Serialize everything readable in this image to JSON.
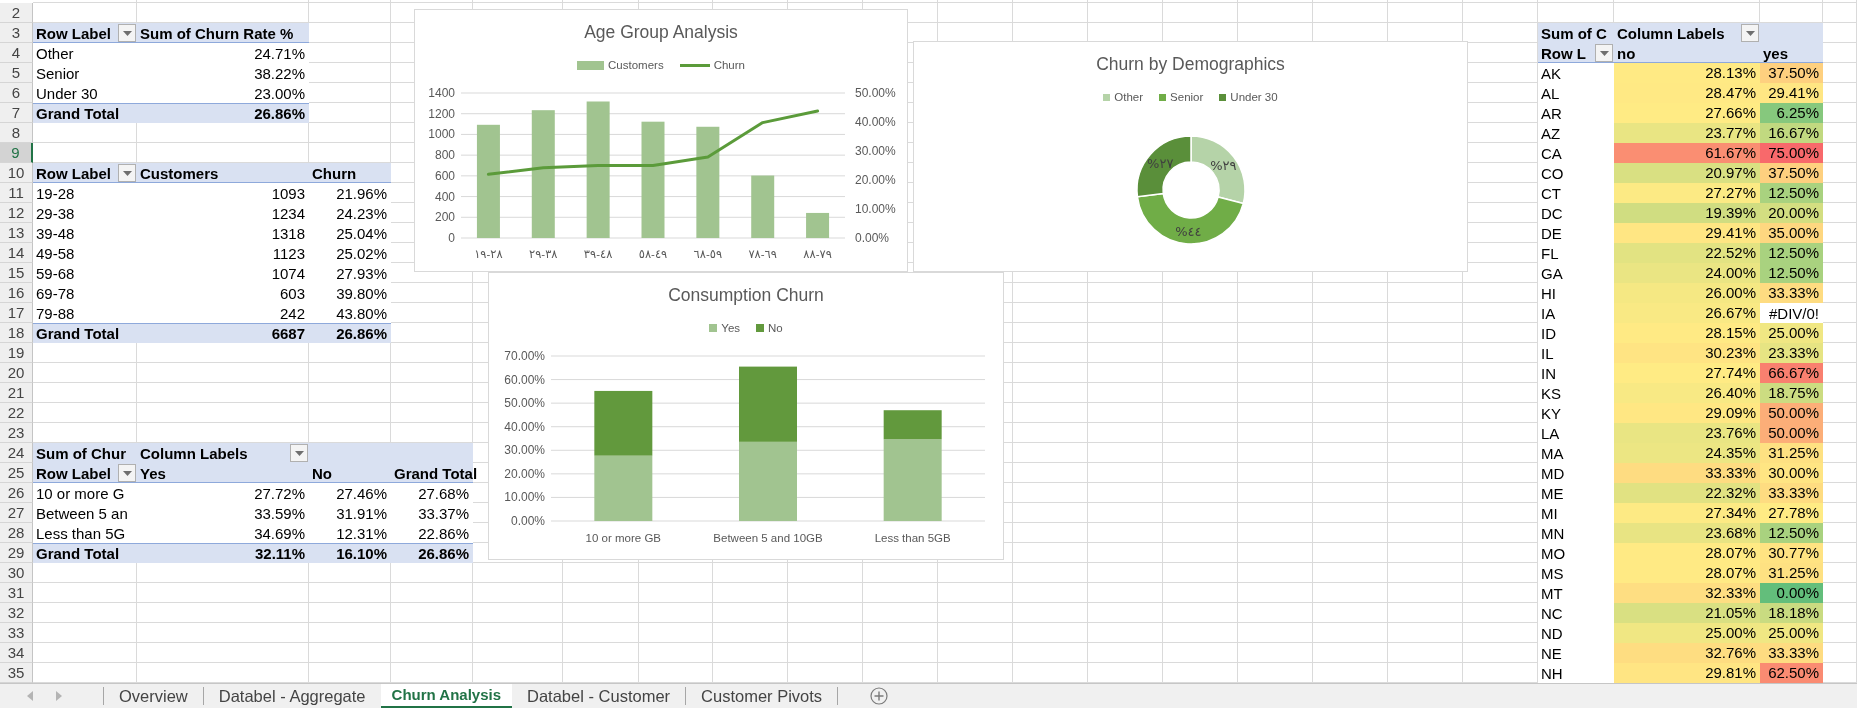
{
  "row_numbers": [
    {
      "label": "2",
      "selected": false
    },
    {
      "label": "3",
      "selected": false
    },
    {
      "label": "4",
      "selected": false
    },
    {
      "label": "5",
      "selected": false
    },
    {
      "label": "6",
      "selected": false
    },
    {
      "label": "7",
      "selected": false
    },
    {
      "label": "8",
      "selected": false
    },
    {
      "label": "9",
      "selected": true
    },
    {
      "label": "10",
      "selected": false
    },
    {
      "label": "11",
      "selected": false
    },
    {
      "label": "12",
      "selected": false
    },
    {
      "label": "13",
      "selected": false
    },
    {
      "label": "14",
      "selected": false
    },
    {
      "label": "15",
      "selected": false
    },
    {
      "label": "16",
      "selected": false
    },
    {
      "label": "17",
      "selected": false
    },
    {
      "label": "18",
      "selected": false
    },
    {
      "label": "19",
      "selected": false
    },
    {
      "label": "20",
      "selected": false
    },
    {
      "label": "21",
      "selected": false
    },
    {
      "label": "22",
      "selected": false
    },
    {
      "label": "23",
      "selected": false
    },
    {
      "label": "24",
      "selected": false
    },
    {
      "label": "25",
      "selected": false
    },
    {
      "label": "26",
      "selected": false
    },
    {
      "label": "27",
      "selected": false
    },
    {
      "label": "28",
      "selected": false
    },
    {
      "label": "29",
      "selected": false
    },
    {
      "label": "30",
      "selected": false
    },
    {
      "label": "31",
      "selected": false
    },
    {
      "label": "32",
      "selected": false
    },
    {
      "label": "33",
      "selected": false
    },
    {
      "label": "34",
      "selected": false
    },
    {
      "label": "35",
      "selected": false
    }
  ],
  "pivot_tables": [
    {
      "header_rows": [
        [
          {
            "text": "Row Label",
            "filter": true
          },
          {
            "text": "Sum of Churn Rate %",
            "filter": false
          }
        ]
      ],
      "rows": [
        [
          "Other",
          "24.71%"
        ],
        [
          "Senior",
          "38.22%"
        ],
        [
          "Under 30",
          "23.00%"
        ]
      ],
      "total": [
        "Grand Total",
        "26.86%"
      ]
    },
    {
      "header_rows": [
        [
          {
            "text": "Row Label",
            "filter": true
          },
          {
            "text": "Customers",
            "filter": false
          },
          {
            "text": "Churn",
            "filter": false
          }
        ]
      ],
      "rows": [
        [
          "19-28",
          "1093",
          "21.96%"
        ],
        [
          "29-38",
          "1234",
          "24.23%"
        ],
        [
          "39-48",
          "1318",
          "25.04%"
        ],
        [
          "49-58",
          "1123",
          "25.02%"
        ],
        [
          "59-68",
          "1074",
          "27.93%"
        ],
        [
          "69-78",
          "603",
          "39.80%"
        ],
        [
          "79-88",
          "242",
          "43.80%"
        ]
      ],
      "total": [
        "Grand Total",
        "6687",
        "26.86%"
      ]
    },
    {
      "header_rows": [
        [
          {
            "text": "Sum of Chur",
            "filter": false
          },
          {
            "text": "Column Labels",
            "filter": true
          }
        ],
        [
          {
            "text": "Row Label",
            "filter": true
          },
          {
            "text": "Yes",
            "filter": false
          },
          {
            "text": "No",
            "filter": false
          },
          {
            "text": "Grand Total",
            "filter": false
          }
        ]
      ],
      "rows": [
        [
          "10 or more G",
          "27.72%",
          "27.46%",
          "27.68%"
        ],
        [
          "Between 5 an",
          "33.59%",
          "31.91%",
          "33.37%"
        ],
        [
          "Less than 5G",
          "34.69%",
          "12.31%",
          "22.86%"
        ]
      ],
      "total": [
        "Grand Total",
        "32.11%",
        "16.10%",
        "26.86%"
      ]
    },
    {
      "header_rows": [
        [
          {
            "text": "Sum of C",
            "filter": false
          },
          {
            "text": "Column Labels",
            "filter": true
          }
        ],
        [
          {
            "text": "Row L",
            "filter": true
          },
          {
            "text": "no",
            "filter": false
          },
          {
            "text": "yes",
            "filter": false
          }
        ]
      ],
      "rows": [
        [
          {
            "text": "AK"
          },
          {
            "text": "28.13%",
            "color": "#ffea84"
          },
          {
            "text": "37.50%",
            "color": "#fed07f"
          }
        ],
        [
          {
            "text": "AL"
          },
          {
            "text": "28.47%",
            "color": "#ffe984"
          },
          {
            "text": "29.41%",
            "color": "#ffe683"
          }
        ],
        [
          {
            "text": "AR"
          },
          {
            "text": "27.66%",
            "color": "#ffeb84"
          },
          {
            "text": "6.25%",
            "color": "#86c87d"
          }
        ],
        [
          {
            "text": "AZ"
          },
          {
            "text": "23.77%",
            "color": "#e9e583"
          },
          {
            "text": "16.67%",
            "color": "#c1d980"
          }
        ],
        [
          {
            "text": "CA"
          },
          {
            "text": "61.67%",
            "color": "#fa8e72"
          },
          {
            "text": "75.00%",
            "color": "#f8696b"
          }
        ],
        [
          {
            "text": "CO"
          },
          {
            "text": "20.97%",
            "color": "#d9e082"
          },
          {
            "text": "37.50%",
            "color": "#fed07f"
          }
        ],
        [
          {
            "text": "CT"
          },
          {
            "text": "27.27%",
            "color": "#fcea84"
          },
          {
            "text": "12.50%",
            "color": "#a9d27f"
          }
        ],
        [
          {
            "text": "DC"
          },
          {
            "text": "19.39%",
            "color": "#d0dd81"
          },
          {
            "text": "20.00%",
            "color": "#d3de81"
          }
        ],
        [
          {
            "text": "DE"
          },
          {
            "text": "29.41%",
            "color": "#ffe683"
          },
          {
            "text": "35.00%",
            "color": "#fed780"
          }
        ],
        [
          {
            "text": "FL"
          },
          {
            "text": "22.52%",
            "color": "#e2e382"
          },
          {
            "text": "12.50%",
            "color": "#a9d27f"
          }
        ],
        [
          {
            "text": "GA"
          },
          {
            "text": "24.00%",
            "color": "#eae583"
          },
          {
            "text": "12.50%",
            "color": "#a9d27f"
          }
        ],
        [
          {
            "text": "HI"
          },
          {
            "text": "26.00%",
            "color": "#f5e883"
          },
          {
            "text": "33.33%",
            "color": "#fedc81"
          }
        ],
        [
          {
            "text": "IA"
          },
          {
            "text": "26.67%",
            "color": "#f9e984"
          },
          {
            "text": "#DIV/0!"
          }
        ],
        [
          {
            "text": "ID"
          },
          {
            "text": "28.15%",
            "color": "#ffea84"
          },
          {
            "text": "25.00%",
            "color": "#f0e783"
          }
        ],
        [
          {
            "text": "IL"
          },
          {
            "text": "30.23%",
            "color": "#ffe483"
          },
          {
            "text": "23.33%",
            "color": "#e6e483"
          }
        ],
        [
          {
            "text": "IN"
          },
          {
            "text": "27.74%",
            "color": "#ffeb84"
          },
          {
            "text": "66.67%",
            "color": "#f9806f"
          }
        ],
        [
          {
            "text": "KS"
          },
          {
            "text": "26.40%",
            "color": "#f8e984"
          },
          {
            "text": "18.75%",
            "color": "#ccdc81"
          }
        ],
        [
          {
            "text": "KY"
          },
          {
            "text": "29.09%",
            "color": "#ffe783"
          },
          {
            "text": "50.00%",
            "color": "#fcae78"
          }
        ],
        [
          {
            "text": "LA"
          },
          {
            "text": "23.76%",
            "color": "#e9e583"
          },
          {
            "text": "50.00%",
            "color": "#fcae78"
          }
        ],
        [
          {
            "text": "MA"
          },
          {
            "text": "24.35%",
            "color": "#ece683"
          },
          {
            "text": "31.25%",
            "color": "#fee182"
          }
        ],
        [
          {
            "text": "MD"
          },
          {
            "text": "33.33%",
            "color": "#fedc81"
          },
          {
            "text": "30.00%",
            "color": "#ffe583"
          }
        ],
        [
          {
            "text": "ME"
          },
          {
            "text": "22.32%",
            "color": "#e1e282"
          },
          {
            "text": "33.33%",
            "color": "#fedc81"
          }
        ],
        [
          {
            "text": "MI"
          },
          {
            "text": "27.34%",
            "color": "#fdea84"
          },
          {
            "text": "27.78%",
            "color": "#ffeb84"
          }
        ],
        [
          {
            "text": "MN"
          },
          {
            "text": "23.68%",
            "color": "#e8e483"
          },
          {
            "text": "12.50%",
            "color": "#a9d27f"
          }
        ],
        [
          {
            "text": "MO"
          },
          {
            "text": "28.07%",
            "color": "#ffea84"
          },
          {
            "text": "30.77%",
            "color": "#ffe382"
          }
        ],
        [
          {
            "text": "MS"
          },
          {
            "text": "28.07%",
            "color": "#ffea84"
          },
          {
            "text": "31.25%",
            "color": "#fee182"
          }
        ],
        [
          {
            "text": "MT"
          },
          {
            "text": "32.33%",
            "color": "#fede82"
          },
          {
            "text": "0.00%",
            "color": "#63be7b"
          }
        ],
        [
          {
            "text": "NC"
          },
          {
            "text": "21.05%",
            "color": "#d9e082"
          },
          {
            "text": "18.18%",
            "color": "#c9db81"
          }
        ],
        [
          {
            "text": "ND"
          },
          {
            "text": "25.00%",
            "color": "#f0e783"
          },
          {
            "text": "25.00%",
            "color": "#f0e783"
          }
        ],
        [
          {
            "text": "NE"
          },
          {
            "text": "32.76%",
            "color": "#fedd81"
          },
          {
            "text": "33.33%",
            "color": "#fedc81"
          }
        ],
        [
          {
            "text": "NH"
          },
          {
            "text": "29.81%",
            "color": "#ffe583"
          },
          {
            "text": "62.50%",
            "color": "#fa8b72"
          }
        ]
      ]
    }
  ],
  "charts": [
    {
      "chart_data": {
        "type": "bar",
        "title": "Age Group Analysis",
        "legend": "top",
        "grid": true,
        "categories": [
          "١٩-٢٨",
          "٢٩-٣٨",
          "٣٩-٤٨",
          "٥٨-٤٩",
          "٦٨-٥٩",
          "٧٨-٦٩",
          "٨٨-٧٩"
        ],
        "series": [
          {
            "name": "Customers",
            "type": "bar",
            "color": "#a1c490",
            "values": [
              1093,
              1234,
              1318,
              1123,
              1074,
              603,
              242
            ]
          },
          {
            "name": "Churn",
            "type": "line",
            "axis": "y2",
            "color": "#5b9b3a",
            "values": [
              0.2196,
              0.2423,
              0.2504,
              0.2502,
              0.2793,
              0.398,
              0.438
            ]
          }
        ],
        "ylim": [
          0,
          1400
        ],
        "yticks": [
          0,
          200,
          400,
          600,
          800,
          1000,
          1200,
          1400
        ],
        "y2lim": [
          0,
          0.5
        ],
        "y2ticks": [
          {
            "value": 0,
            "label": "0.00%"
          },
          {
            "value": 0.1,
            "label": "10.00%"
          },
          {
            "value": 0.2,
            "label": "20.00%"
          },
          {
            "value": 0.3,
            "label": "30.00%"
          },
          {
            "value": 0.4,
            "label": "40.00%"
          },
          {
            "value": 0.5,
            "label": "50.00%"
          }
        ]
      }
    },
    {
      "chart_data": {
        "type": "donut",
        "title": "Churn by Demographics",
        "legend": "top",
        "categories": [
          "Other",
          "Senior",
          "Under 30"
        ],
        "values": [
          29,
          44,
          27
        ],
        "colors": [
          "#b5d3a8",
          "#70ad47",
          "#5a8f3a"
        ],
        "value_labels": [
          "%٢٩",
          "%٤٤",
          "%٢٧"
        ]
      }
    },
    {
      "chart_data": {
        "type": "bar",
        "stacked": true,
        "title": "Consumption Churn",
        "legend": "top",
        "grid": true,
        "categories": [
          "10 or more GB",
          "Between 5 and 10GB",
          "Less than 5GB"
        ],
        "series": [
          {
            "name": "Yes",
            "color": "#a1c490",
            "values": [
              0.2772,
              0.3359,
              0.3469
            ]
          },
          {
            "name": "No",
            "color": "#62993d",
            "values": [
              0.2746,
              0.3191,
              0.1231
            ]
          }
        ],
        "ylim": [
          0,
          0.7
        ],
        "yticks": [
          {
            "value": 0,
            "label": "0.00%"
          },
          {
            "value": 0.1,
            "label": "10.00%"
          },
          {
            "value": 0.2,
            "label": "20.00%"
          },
          {
            "value": 0.3,
            "label": "30.00%"
          },
          {
            "value": 0.4,
            "label": "40.00%"
          },
          {
            "value": 0.5,
            "label": "50.00%"
          },
          {
            "value": 0.6,
            "label": "60.00%"
          },
          {
            "value": 0.7,
            "label": "70.00%"
          }
        ]
      }
    }
  ],
  "sheet_tabs": [
    {
      "label": "Overview",
      "selected": false
    },
    {
      "label": "Databel - Aggregate",
      "selected": false
    },
    {
      "label": "Churn Analysis",
      "selected": true
    },
    {
      "label": "Databel - Customer",
      "selected": false
    },
    {
      "label": "Customer Pivots",
      "selected": false
    }
  ]
}
